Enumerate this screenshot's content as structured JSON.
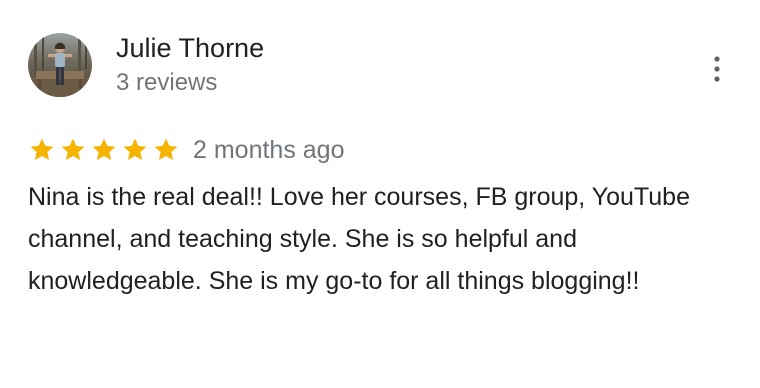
{
  "reviewer": {
    "name": "Julie Thorne",
    "review_count": "3 reviews",
    "avatar_icon": "reviewer-photo"
  },
  "menu": {
    "icon": "more-vertical-icon"
  },
  "review": {
    "rating": 5,
    "max_rating": 5,
    "date": "2 months ago",
    "text": "Nina is the real deal!! Love her courses, FB group, YouTube channel, and teaching style. She is so helpful and knowledgeable. She is my go-to for all things blogging!!"
  },
  "colors": {
    "star": "#f4b400",
    "name": "#202124",
    "secondary": "#70757a",
    "menu_dots": "#5f6368"
  }
}
